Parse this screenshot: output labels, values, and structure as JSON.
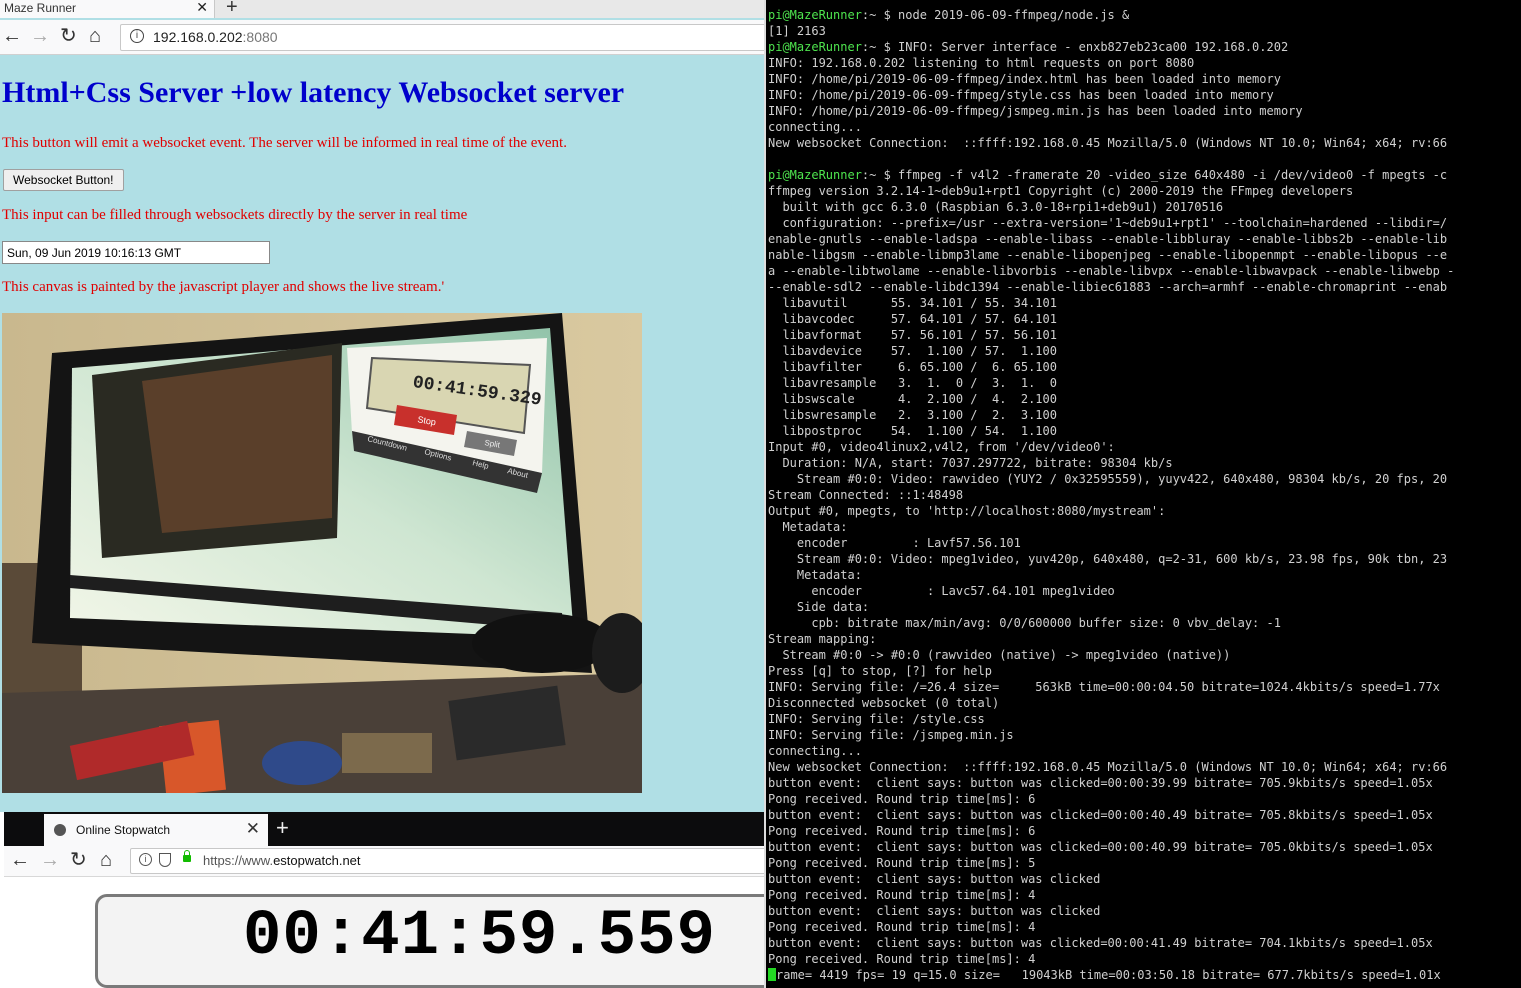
{
  "left_browser": {
    "tab_title": "Maze Runner",
    "tab_close": "✕",
    "new_tab": "+",
    "url_host": "192.168.0.202",
    "url_port": ":8080",
    "page": {
      "title": "Html+Css Server +low latency Websocket server",
      "button_desc": "This button will emit a websocket event. The server will be informed in real time of the event.",
      "button_label": "Websocket Button!",
      "input_desc": "This input can be filled through websockets directly by the server in real time",
      "input_value": "Sun, 09 Jun 2019 10:16:13 GMT",
      "canvas_desc": "This canvas is painted by the javascript player and shows the live stream.'",
      "canvas_stopwatch_time": "00:41:59.329",
      "canvas_stop_label": "Stop",
      "canvas_split_label": "Split",
      "canvas_menu": [
        "Countdown",
        "Options",
        "Help",
        "About"
      ]
    }
  },
  "stopwatch_browser": {
    "tab_title": "Online Stopwatch",
    "tab_close": "✕",
    "new_tab": "+",
    "url_scheme": "https://www.",
    "url_host": "estopwatch.net",
    "time": "00:41:59.559"
  },
  "terminal": {
    "lines": [
      {
        "p": "pi@MazeRunner",
        "s": ":~ $ ",
        "t": "node 2019-06-09-ffmpeg/node.js &"
      },
      {
        "t": "[1] 2163"
      },
      {
        "p": "pi@MazeRunner",
        "s": ":~ $ ",
        "t": "INFO: Server interface - enxb827eb23ca00 192.168.0.202"
      },
      {
        "t": "INFO: 192.168.0.202 listening to html requests on port 8080"
      },
      {
        "t": "INFO: /home/pi/2019-06-09-ffmpeg/index.html has been loaded into memory"
      },
      {
        "t": "INFO: /home/pi/2019-06-09-ffmpeg/style.css has been loaded into memory"
      },
      {
        "t": "INFO: /home/pi/2019-06-09-ffmpeg/jsmpeg.min.js has been loaded into memory"
      },
      {
        "t": "connecting..."
      },
      {
        "t": "New websocket Connection:  ::ffff:192.168.0.45 Mozilla/5.0 (Windows NT 10.0; Win64; x64; rv:66"
      },
      {
        "t": ""
      },
      {
        "p": "pi@MazeRunner",
        "s": ":~ $ ",
        "t": "ffmpeg -f v4l2 -framerate 20 -video_size 640x480 -i /dev/video0 -f mpegts -c"
      },
      {
        "t": "ffmpeg version 3.2.14-1~deb9u1+rpt1 Copyright (c) 2000-2019 the FFmpeg developers"
      },
      {
        "t": "  built with gcc 6.3.0 (Raspbian 6.3.0-18+rpi1+deb9u1) 20170516"
      },
      {
        "t": "  configuration: --prefix=/usr --extra-version='1~deb9u1+rpt1' --toolchain=hardened --libdir=/"
      },
      {
        "t": "enable-gnutls --enable-ladspa --enable-libass --enable-libbluray --enable-libbs2b --enable-lib"
      },
      {
        "t": "nable-libgsm --enable-libmp3lame --enable-libopenjpeg --enable-libopenmpt --enable-libopus --e"
      },
      {
        "t": "a --enable-libtwolame --enable-libvorbis --enable-libvpx --enable-libwavpack --enable-libwebp -"
      },
      {
        "t": "--enable-sdl2 --enable-libdc1394 --enable-libiec61883 --arch=armhf --enable-chromaprint --enab"
      },
      {
        "t": "  libavutil      55. 34.101 / 55. 34.101"
      },
      {
        "t": "  libavcodec     57. 64.101 / 57. 64.101"
      },
      {
        "t": "  libavformat    57. 56.101 / 57. 56.101"
      },
      {
        "t": "  libavdevice    57.  1.100 / 57.  1.100"
      },
      {
        "t": "  libavfilter     6. 65.100 /  6. 65.100"
      },
      {
        "t": "  libavresample   3.  1.  0 /  3.  1.  0"
      },
      {
        "t": "  libswscale      4.  2.100 /  4.  2.100"
      },
      {
        "t": "  libswresample   2.  3.100 /  2.  3.100"
      },
      {
        "t": "  libpostproc    54.  1.100 / 54.  1.100"
      },
      {
        "t": "Input #0, video4linux2,v4l2, from '/dev/video0':"
      },
      {
        "t": "  Duration: N/A, start: 7037.297722, bitrate: 98304 kb/s"
      },
      {
        "t": "    Stream #0:0: Video: rawvideo (YUY2 / 0x32595559), yuyv422, 640x480, 98304 kb/s, 20 fps, 20"
      },
      {
        "t": "Stream Connected: ::1:48498"
      },
      {
        "t": "Output #0, mpegts, to 'http://localhost:8080/mystream':"
      },
      {
        "t": "  Metadata:"
      },
      {
        "t": "    encoder         : Lavf57.56.101"
      },
      {
        "t": "    Stream #0:0: Video: mpeg1video, yuv420p, 640x480, q=2-31, 600 kb/s, 23.98 fps, 90k tbn, 23"
      },
      {
        "t": "    Metadata:"
      },
      {
        "t": "      encoder         : Lavc57.64.101 mpeg1video"
      },
      {
        "t": "    Side data:"
      },
      {
        "t": "      cpb: bitrate max/min/avg: 0/0/600000 buffer size: 0 vbv_delay: -1"
      },
      {
        "t": "Stream mapping:"
      },
      {
        "t": "  Stream #0:0 -> #0:0 (rawvideo (native) -> mpeg1video (native))"
      },
      {
        "t": "Press [q] to stop, [?] for help"
      },
      {
        "t": "INFO: Serving file: /=26.4 size=     563kB time=00:00:04.50 bitrate=1024.4kbits/s speed=1.77x"
      },
      {
        "t": "Disconnected websocket (0 total)"
      },
      {
        "t": "INFO: Serving file: /style.css"
      },
      {
        "t": "INFO: Serving file: /jsmpeg.min.js"
      },
      {
        "t": "connecting..."
      },
      {
        "t": "New websocket Connection:  ::ffff:192.168.0.45 Mozilla/5.0 (Windows NT 10.0; Win64; x64; rv:66"
      },
      {
        "t": "button event:  client says: button was clicked=00:00:39.99 bitrate= 705.9kbits/s speed=1.05x"
      },
      {
        "t": "Pong received. Round trip time[ms]: 6"
      },
      {
        "t": "button event:  client says: button was clicked=00:00:40.49 bitrate= 705.8kbits/s speed=1.05x"
      },
      {
        "t": "Pong received. Round trip time[ms]: 6"
      },
      {
        "t": "button event:  client says: button was clicked=00:00:40.99 bitrate= 705.0kbits/s speed=1.05x"
      },
      {
        "t": "Pong received. Round trip time[ms]: 5"
      },
      {
        "t": "button event:  client says: button was clicked"
      },
      {
        "t": "Pong received. Round trip time[ms]: 4"
      },
      {
        "t": "button event:  client says: button was clicked"
      },
      {
        "t": "Pong received. Round trip time[ms]: 4"
      },
      {
        "t": "button event:  client says: button was clicked=00:00:41.49 bitrate= 704.1kbits/s speed=1.05x"
      },
      {
        "t": "Pong received. Round trip time[ms]: 4"
      },
      {
        "cursor": true,
        "t": "rame= 4419 fps= 19 q=15.0 size=   19043kB time=00:03:50.18 bitrate= 677.7kbits/s speed=1.01x"
      }
    ]
  }
}
